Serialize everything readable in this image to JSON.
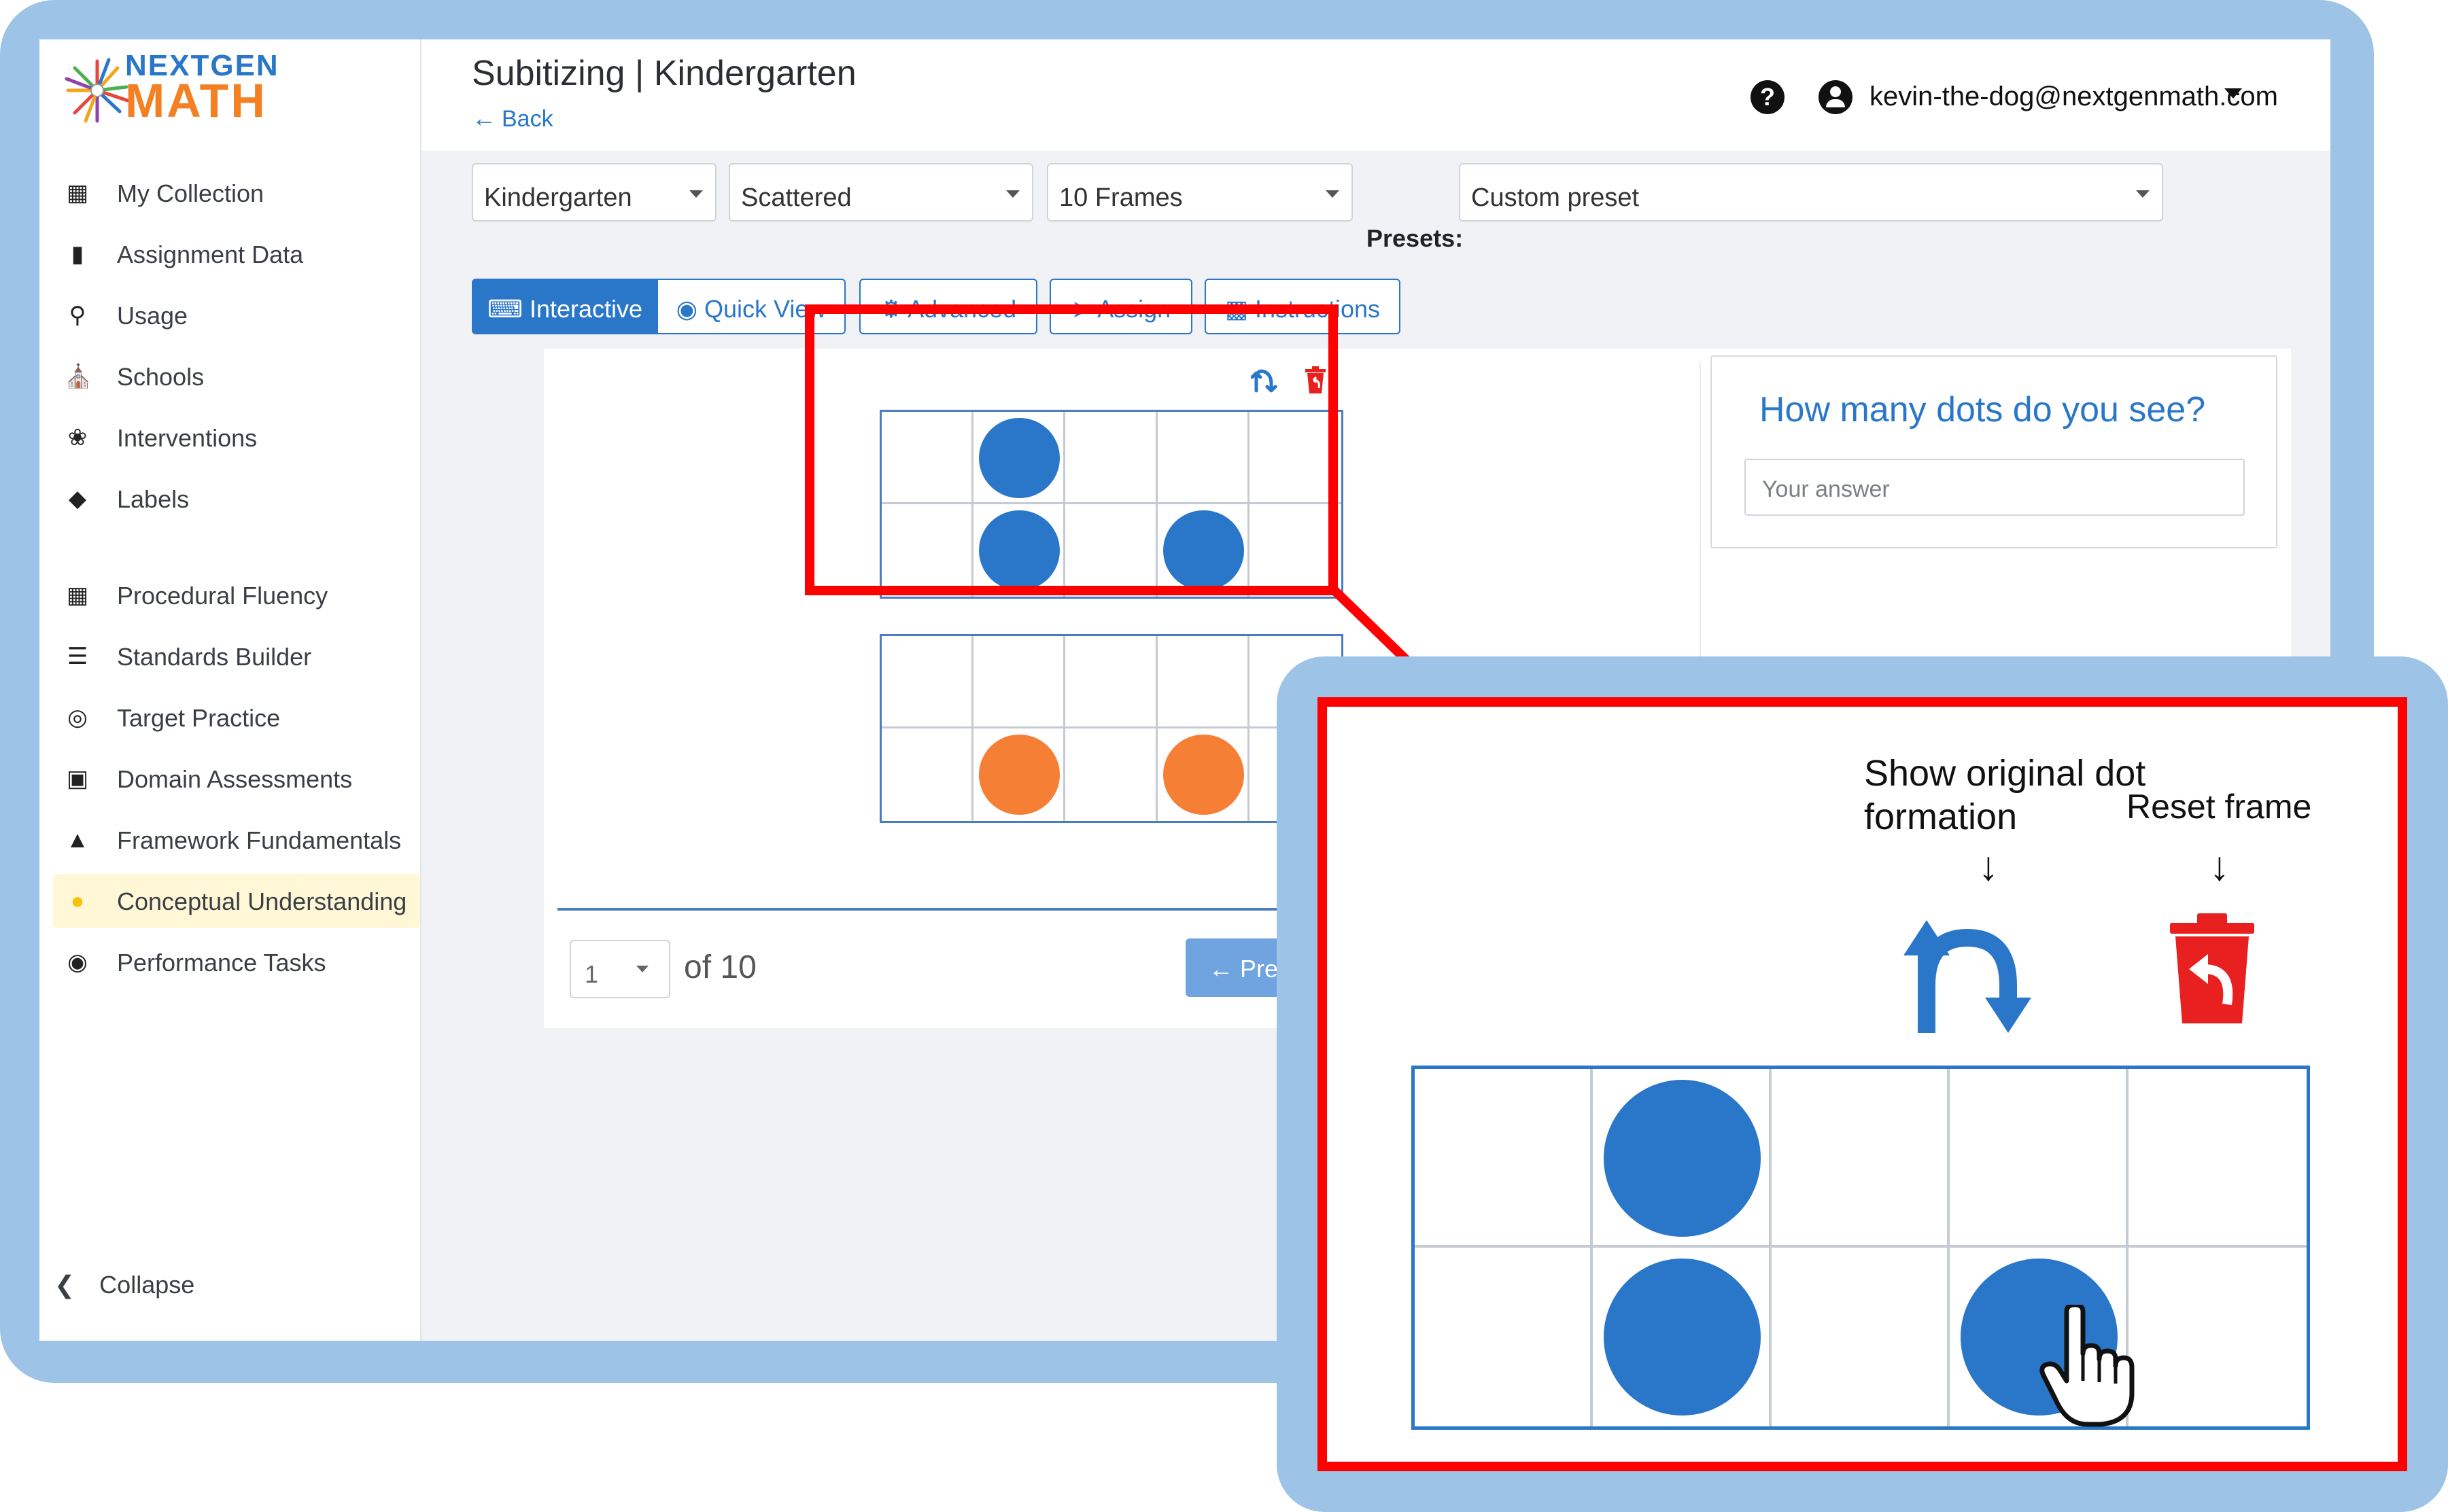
{
  "app": {
    "logo": {
      "top": "NEXTGEN",
      "bottom": "MATH"
    },
    "page_title": "Subitizing | Kindergarten",
    "back_label": "Back",
    "help_icon": "?",
    "user_email": "kevin-the-dog@nextgenmath.com"
  },
  "sidebar": {
    "items": [
      {
        "label": "My Collection",
        "icon": "books-icon"
      },
      {
        "label": "Assignment Data",
        "icon": "bar-chart-icon"
      },
      {
        "label": "Usage",
        "icon": "magnify-chart-icon"
      },
      {
        "label": "Schools",
        "icon": "school-icon"
      },
      {
        "label": "Interventions",
        "icon": "hand-seedling-icon"
      },
      {
        "label": "Labels",
        "icon": "tag-icon"
      },
      {
        "label": "Procedural Fluency",
        "icon": "grid-icon"
      },
      {
        "label": "Standards Builder",
        "icon": "list-tree-icon"
      },
      {
        "label": "Target Practice",
        "icon": "target-icon"
      },
      {
        "label": "Domain Assessments",
        "icon": "cubes-icon"
      },
      {
        "label": "Framework Fundamentals",
        "icon": "shapes-icon"
      },
      {
        "label": "Conceptual Understanding",
        "icon": "lightbulb-head-icon",
        "active": true
      },
      {
        "label": "Performance Tasks",
        "icon": "globe-icon"
      }
    ],
    "collapse_label": "Collapse"
  },
  "filters": {
    "grade": "Kindergarten",
    "arrangement": "Scattered",
    "frame_type": "10 Frames",
    "presets_label": "Presets:",
    "preset_value": "Custom preset"
  },
  "tabs": {
    "interactive": "Interactive",
    "quick_view": "Quick View",
    "advanced": "Advanced",
    "assign": "Assign",
    "instructions": "Instructions"
  },
  "question": {
    "text": "How many dots do you see?",
    "answer_placeholder": "Your answer"
  },
  "pager": {
    "current": "1",
    "of_total": "of 10",
    "previous": "Previous"
  },
  "callout": {
    "show_original": "Show original dot formation",
    "reset_frame": "Reset frame"
  },
  "frames": {
    "top_blue_dots": [
      [
        0,
        1
      ],
      [
        1,
        1
      ],
      [
        1,
        3
      ]
    ],
    "bottom_orange_dots": [
      [
        1,
        1
      ],
      [
        1,
        3
      ]
    ]
  },
  "colors": {
    "accent": "#2a77c9",
    "highlight": "#ff0000",
    "frame_border": "#9dc3e6",
    "dot_blue": "#2a77c9",
    "dot_orange": "#f57f34"
  }
}
